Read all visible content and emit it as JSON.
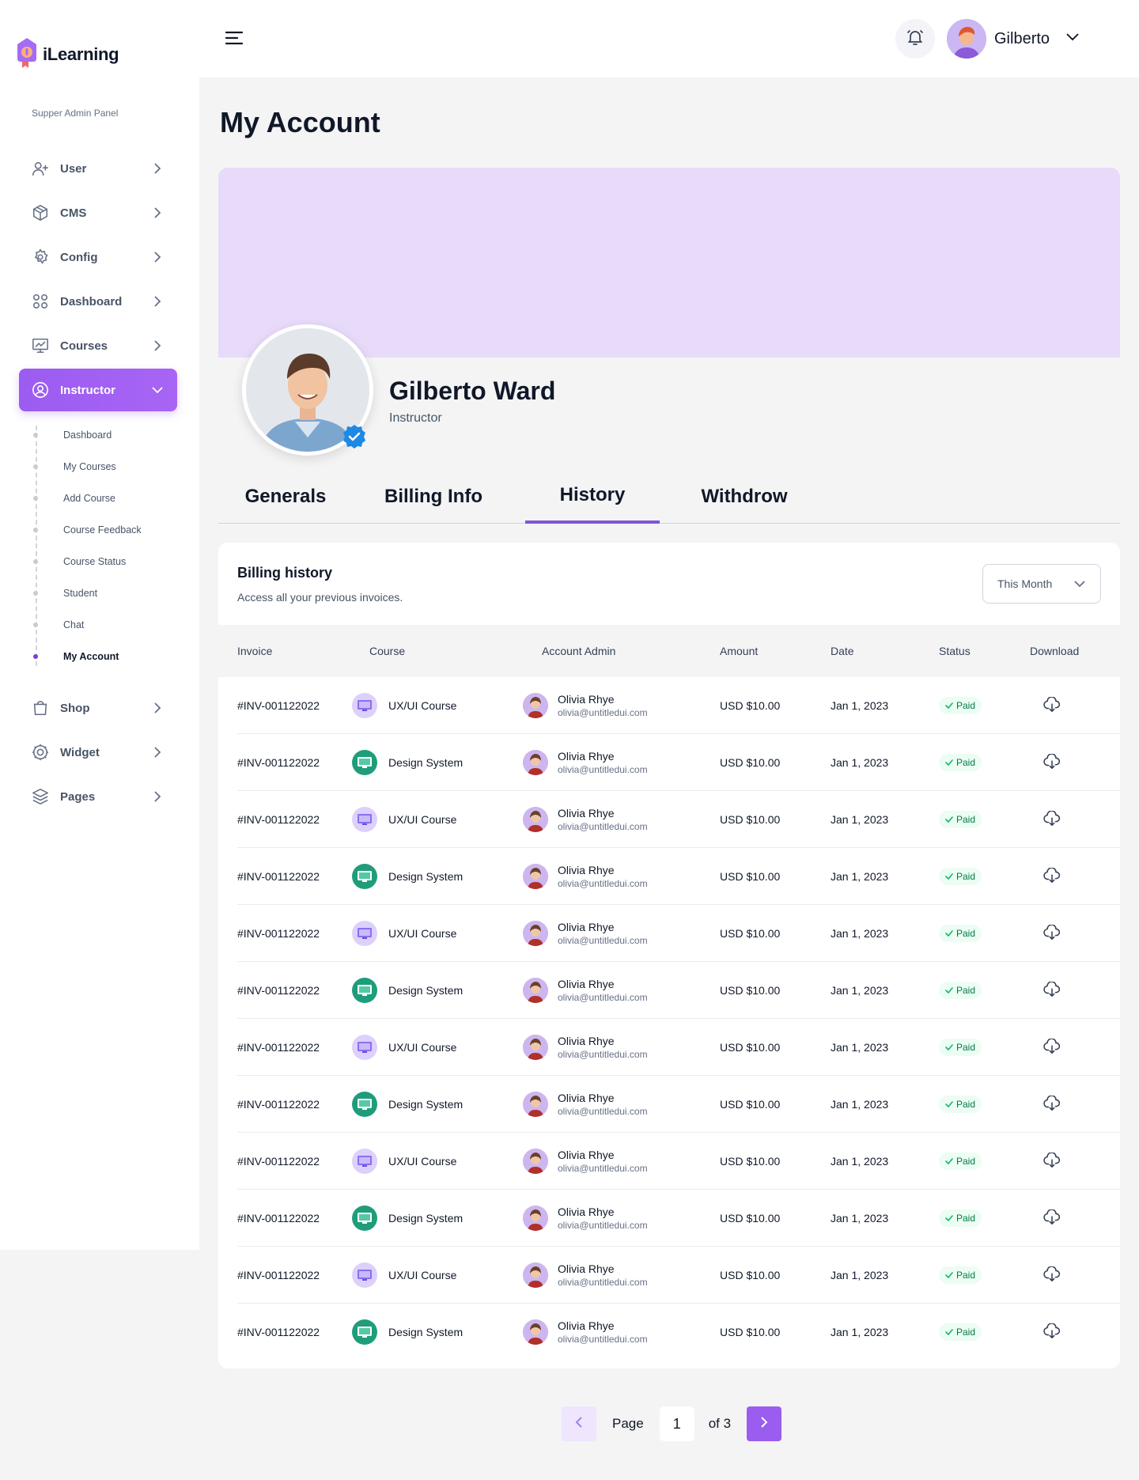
{
  "brand": {
    "name": "iLearning",
    "panel_label": "Supper Admin Panel"
  },
  "sidebar": {
    "items_top": [
      {
        "label": "User",
        "icon": "user-plus-icon"
      },
      {
        "label": "CMS",
        "icon": "box-icon"
      },
      {
        "label": "Config",
        "icon": "gear-icon"
      },
      {
        "label": "Dashboard",
        "icon": "grid-icon"
      },
      {
        "label": "Courses",
        "icon": "presentation-icon"
      }
    ],
    "active_item": {
      "label": "Instructor",
      "icon": "user-circle-icon"
    },
    "sub_items": [
      "Dashboard",
      "My Courses",
      "Add Course",
      "Course Feedback",
      "Course Status",
      "Student",
      "Chat",
      "My Account"
    ],
    "active_sub_item": "My Account",
    "items_bottom": [
      {
        "label": "Shop",
        "icon": "shopping-bag-icon"
      },
      {
        "label": "Widget",
        "icon": "widget-icon"
      },
      {
        "label": "Pages",
        "icon": "layers-icon"
      }
    ]
  },
  "topbar": {
    "user_name": "Gilberto"
  },
  "page": {
    "title": "My Account"
  },
  "profile": {
    "name": "Gilberto Ward",
    "role": "Instructor"
  },
  "tabs": [
    "Generals",
    "Billing Info",
    "History",
    "Withdrow"
  ],
  "active_tab": "History",
  "billing": {
    "title": "Billing history",
    "subtitle": "Access all your previous invoices.",
    "filter": "This Month",
    "columns": [
      "Invoice",
      "Course",
      "Account Admin",
      "Amount",
      "Date",
      "Status",
      "Download"
    ],
    "rows": [
      {
        "invoice": "#INV-001122022",
        "course": "UX/UI Course",
        "course_type": "ux",
        "admin_name": "Olivia Rhye",
        "admin_email": "olivia@untitledui.com",
        "amount": "USD $10.00",
        "date": "Jan 1, 2023",
        "status": "Paid"
      },
      {
        "invoice": "#INV-001122022",
        "course": "Design System",
        "course_type": "ds",
        "admin_name": "Olivia Rhye",
        "admin_email": "olivia@untitledui.com",
        "amount": "USD $10.00",
        "date": "Jan 1, 2023",
        "status": "Paid"
      },
      {
        "invoice": "#INV-001122022",
        "course": "UX/UI Course",
        "course_type": "ux",
        "admin_name": "Olivia Rhye",
        "admin_email": "olivia@untitledui.com",
        "amount": "USD $10.00",
        "date": "Jan 1, 2023",
        "status": "Paid"
      },
      {
        "invoice": "#INV-001122022",
        "course": "Design System",
        "course_type": "ds",
        "admin_name": "Olivia Rhye",
        "admin_email": "olivia@untitledui.com",
        "amount": "USD $10.00",
        "date": "Jan 1, 2023",
        "status": "Paid"
      },
      {
        "invoice": "#INV-001122022",
        "course": "UX/UI Course",
        "course_type": "ux",
        "admin_name": "Olivia Rhye",
        "admin_email": "olivia@untitledui.com",
        "amount": "USD $10.00",
        "date": "Jan 1, 2023",
        "status": "Paid"
      },
      {
        "invoice": "#INV-001122022",
        "course": "Design System",
        "course_type": "ds",
        "admin_name": "Olivia Rhye",
        "admin_email": "olivia@untitledui.com",
        "amount": "USD $10.00",
        "date": "Jan 1, 2023",
        "status": "Paid"
      },
      {
        "invoice": "#INV-001122022",
        "course": "UX/UI Course",
        "course_type": "ux",
        "admin_name": "Olivia Rhye",
        "admin_email": "olivia@untitledui.com",
        "amount": "USD $10.00",
        "date": "Jan 1, 2023",
        "status": "Paid"
      },
      {
        "invoice": "#INV-001122022",
        "course": "Design System",
        "course_type": "ds",
        "admin_name": "Olivia Rhye",
        "admin_email": "olivia@untitledui.com",
        "amount": "USD $10.00",
        "date": "Jan 1, 2023",
        "status": "Paid"
      },
      {
        "invoice": "#INV-001122022",
        "course": "UX/UI Course",
        "course_type": "ux",
        "admin_name": "Olivia Rhye",
        "admin_email": "olivia@untitledui.com",
        "amount": "USD $10.00",
        "date": "Jan 1, 2023",
        "status": "Paid"
      },
      {
        "invoice": "#INV-001122022",
        "course": "Design System",
        "course_type": "ds",
        "admin_name": "Olivia Rhye",
        "admin_email": "olivia@untitledui.com",
        "amount": "USD $10.00",
        "date": "Jan 1, 2023",
        "status": "Paid"
      },
      {
        "invoice": "#INV-001122022",
        "course": "UX/UI Course",
        "course_type": "ux",
        "admin_name": "Olivia Rhye",
        "admin_email": "olivia@untitledui.com",
        "amount": "USD $10.00",
        "date": "Jan 1, 2023",
        "status": "Paid"
      },
      {
        "invoice": "#INV-001122022",
        "course": "Design System",
        "course_type": "ds",
        "admin_name": "Olivia Rhye",
        "admin_email": "olivia@untitledui.com",
        "amount": "USD $10.00",
        "date": "Jan 1, 2023",
        "status": "Paid"
      }
    ]
  },
  "pagination": {
    "label": "Page",
    "current": "1",
    "of_label": "of 3"
  },
  "colors": {
    "accent": "#9b5cf0",
    "cover": "#e8daf9",
    "paid_bg": "#ecfdf3",
    "paid_text": "#027a48"
  }
}
